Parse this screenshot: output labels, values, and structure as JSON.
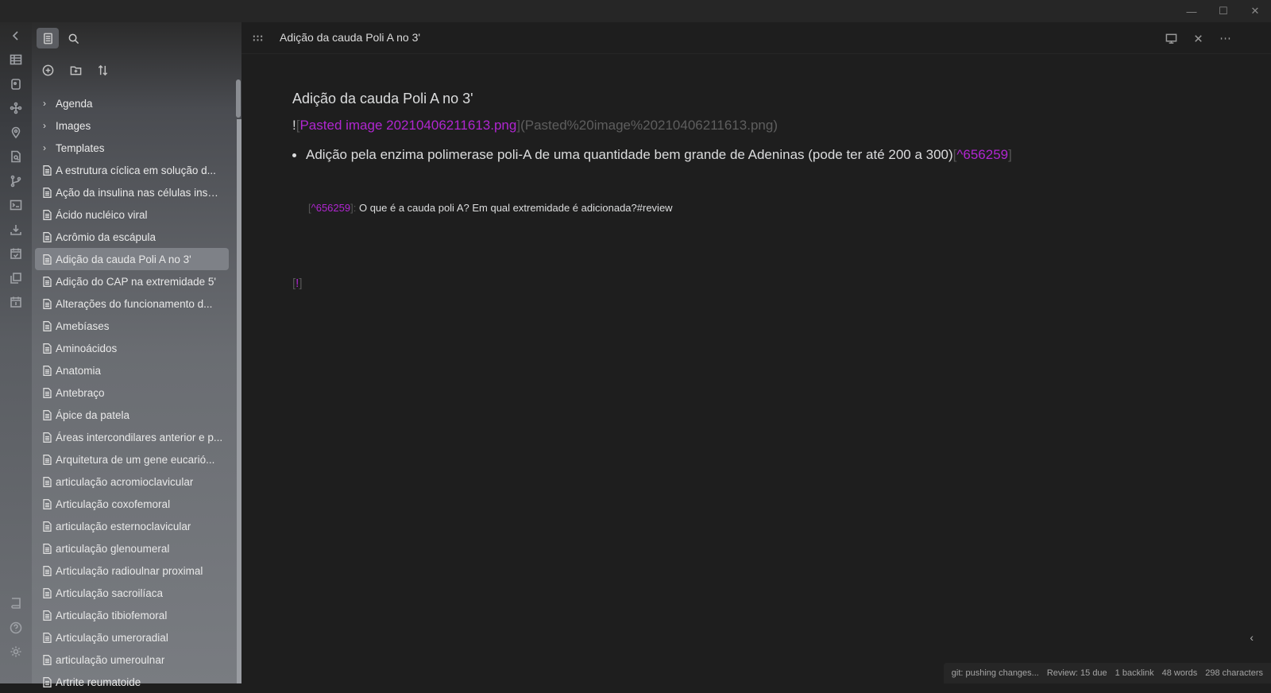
{
  "window": {
    "controls": {
      "minimize": "—",
      "maximize": "☐",
      "close": "✕"
    }
  },
  "ribbon": {
    "icons": [
      "chevron-left-icon",
      "table-icon",
      "dice-icon",
      "graph-icon",
      "location-icon",
      "file-search-icon",
      "fork-icon",
      "terminal-icon",
      "import-icon",
      "calendar-check-icon",
      "copy-icon",
      "calendar-icon",
      "book-icon",
      "help-icon",
      "settings-icon"
    ]
  },
  "sidebar": {
    "tabs": [
      "file-explorer",
      "search"
    ],
    "actions": [
      "new-note",
      "new-folder",
      "sort"
    ],
    "folders": [
      {
        "label": "Agenda"
      },
      {
        "label": "Images"
      },
      {
        "label": "Templates"
      }
    ],
    "files": [
      {
        "label": "A estrutura cíclica em solução d..."
      },
      {
        "label": "Ação da insulina nas células insul..."
      },
      {
        "label": "Ácido nucléico viral"
      },
      {
        "label": "Acrômio da escápula"
      },
      {
        "label": "Adição da cauda Poli A no 3'",
        "active": true
      },
      {
        "label": "Adição do CAP na extremidade 5'"
      },
      {
        "label": "Alterações do funcionamento d..."
      },
      {
        "label": "Amebíases"
      },
      {
        "label": "Aminoácidos"
      },
      {
        "label": "Anatomia"
      },
      {
        "label": "Antebraço"
      },
      {
        "label": "Ápice da patela"
      },
      {
        "label": "Áreas intercondilares anterior e p..."
      },
      {
        "label": "Arquitetura de um gene eucarió..."
      },
      {
        "label": "articulação acromioclavicular"
      },
      {
        "label": "Articulação coxofemoral"
      },
      {
        "label": "articulação esternoclavicular"
      },
      {
        "label": "articulação glenoumeral"
      },
      {
        "label": "Articulação radioulnar proximal"
      },
      {
        "label": "Articulação sacroilíaca"
      },
      {
        "label": "Articulação tibiofemoral"
      },
      {
        "label": "Articulação umeroradial"
      },
      {
        "label": "articulação umeroulnar"
      },
      {
        "label": "Artrite reumatoide"
      }
    ]
  },
  "editor": {
    "header_title": "Adição da cauda Poli A no 3'",
    "title": "Adição da cauda Poli A no 3'",
    "embed": {
      "prefix": "!",
      "open1": "[",
      "link_text": "Pasted image 20210406211613.png",
      "close1": "]",
      "open2": "(",
      "link_url": "Pasted%20image%20210406211613.png",
      "close2": ")"
    },
    "bullet": {
      "text": "Adição pela enzima polimerase poli-A de uma quantidade bem grande de Adeninas (pode ter até 200 a 300)",
      "ref_open": "[",
      "ref": "^656259",
      "ref_close": "]"
    },
    "block": {
      "open": "[",
      "ref": "^656259",
      "close": "]:",
      "text": "O que é a cauda poli A? Em qual extremidade é adicionada?#review"
    },
    "excl": {
      "open": "[",
      "mark": "!",
      "close": "]"
    }
  },
  "status": {
    "git": "git: pushing changes...",
    "review": "Review: 15 due",
    "backlinks": "1 backlink",
    "words": "48 words",
    "chars": "298 characters"
  },
  "colors": {
    "accent": "#b026d0",
    "background": "#1e1e1e"
  }
}
